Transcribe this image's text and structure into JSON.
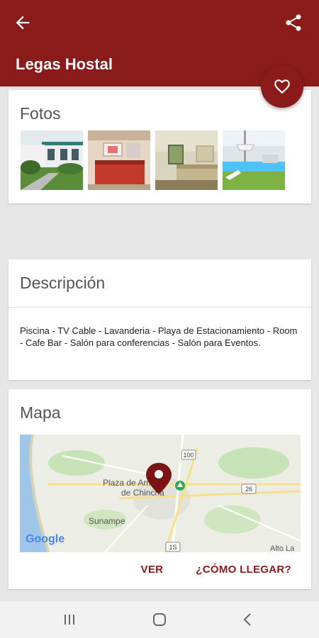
{
  "app_bar": {
    "title": "Legas Hostal",
    "back_icon": "arrow-back-icon",
    "share_icon": "share-icon",
    "background": "#8b1a1a"
  },
  "fab": {
    "icon": "heart-outline-icon"
  },
  "fotos": {
    "title": "Fotos",
    "photos": [
      {
        "name": "photo-exterior-garden"
      },
      {
        "name": "photo-reception"
      },
      {
        "name": "photo-bedroom"
      },
      {
        "name": "photo-pool"
      }
    ]
  },
  "descripcion": {
    "title": "Descripción",
    "text": "Piscina - TV Cable - Lavanderia - Playa de Estacionamiento - Room - Cafe Bar - Salón para conferencias - Salón para Eventos."
  },
  "mapa": {
    "title": "Mapa",
    "map_labels": {
      "plaza": "Plaza de Armas",
      "plaza_line2": "de Chincha",
      "town": "Sunampe",
      "alto": "Alto La",
      "road_100": "100",
      "road_26": "26",
      "road_bottom": "1S",
      "attribution": "Google"
    },
    "actions": {
      "ver": "VER",
      "como_llegar": "¿CÓMO LLEGAR?"
    }
  },
  "system_nav": {
    "recent": "recent-apps-icon",
    "home": "home-icon",
    "back": "nav-back-icon"
  }
}
